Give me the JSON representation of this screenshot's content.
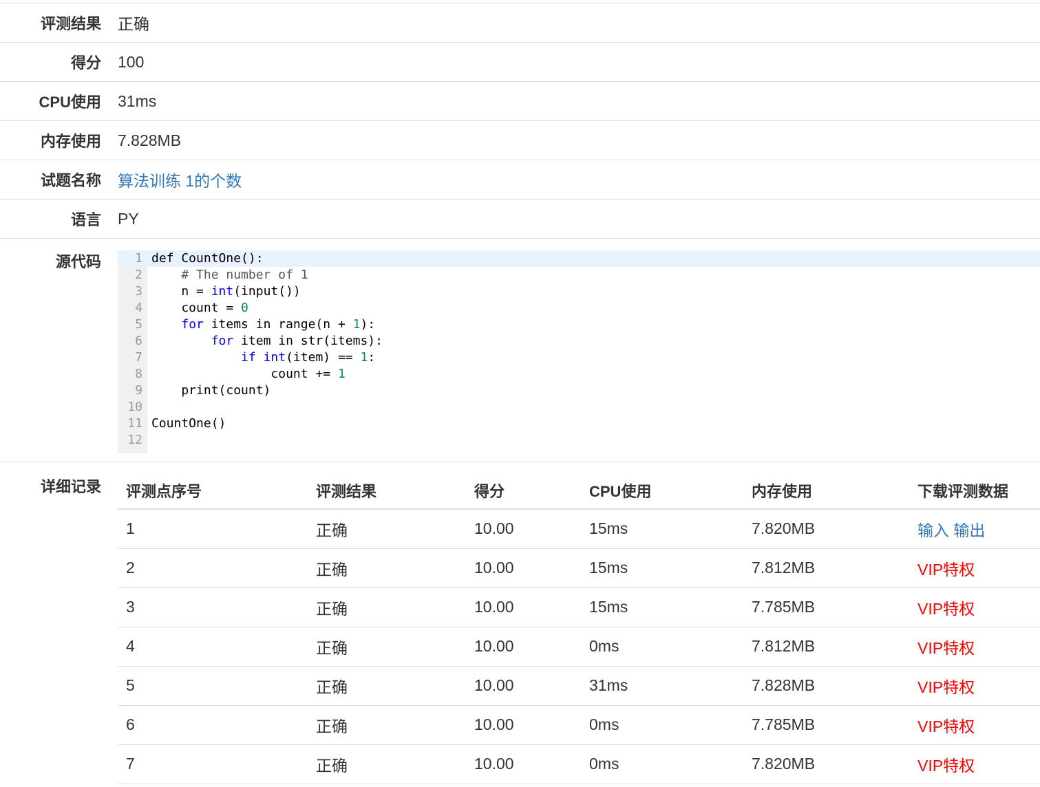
{
  "summary": {
    "result_label": "评测结果",
    "result_value": "正确",
    "score_label": "得分",
    "score_value": "100",
    "cpu_label": "CPU使用",
    "cpu_value": "31ms",
    "mem_label": "内存使用",
    "mem_value": "7.828MB",
    "problem_label": "试题名称",
    "problem_value": "算法训练 1的个数",
    "lang_label": "语言",
    "lang_value": "PY",
    "source_label": "源代码",
    "detail_label": "详细记录"
  },
  "source_code": {
    "line_numbers": [
      "1",
      "2",
      "3",
      "4",
      "5",
      "6",
      "7",
      "8",
      "9",
      "10",
      "11",
      "12"
    ],
    "lines": [
      "def CountOne():",
      "    # The number of 1",
      "    n = int(input())",
      "    count = 0",
      "    for items in range(n + 1):",
      "        for item in str(items):",
      "            if int(item) == 1:",
      "                count += 1",
      "    print(count)",
      "",
      "CountOne()",
      ""
    ]
  },
  "records": {
    "headers": [
      "评测点序号",
      "评测结果",
      "得分",
      "CPU使用",
      "内存使用",
      "下载评测数据"
    ],
    "rows": [
      {
        "id": "1",
        "result": "正确",
        "score": "10.00",
        "cpu": "15ms",
        "mem": "7.820MB",
        "input_link": "输入",
        "output_link": "输出"
      },
      {
        "id": "2",
        "result": "正确",
        "score": "10.00",
        "cpu": "15ms",
        "mem": "7.812MB",
        "vip": "VIP特权"
      },
      {
        "id": "3",
        "result": "正确",
        "score": "10.00",
        "cpu": "15ms",
        "mem": "7.785MB",
        "vip": "VIP特权"
      },
      {
        "id": "4",
        "result": "正确",
        "score": "10.00",
        "cpu": "0ms",
        "mem": "7.812MB",
        "vip": "VIP特权"
      },
      {
        "id": "5",
        "result": "正确",
        "score": "10.00",
        "cpu": "31ms",
        "mem": "7.828MB",
        "vip": "VIP特权"
      },
      {
        "id": "6",
        "result": "正确",
        "score": "10.00",
        "cpu": "0ms",
        "mem": "7.785MB",
        "vip": "VIP特权"
      },
      {
        "id": "7",
        "result": "正确",
        "score": "10.00",
        "cpu": "0ms",
        "mem": "7.820MB",
        "vip": "VIP特权"
      }
    ]
  },
  "colors": {
    "link": "#337ab7",
    "vip": "#ff0000",
    "keyword": "#0000ff",
    "number": "#098658",
    "active_line": "#e8f2ff"
  }
}
